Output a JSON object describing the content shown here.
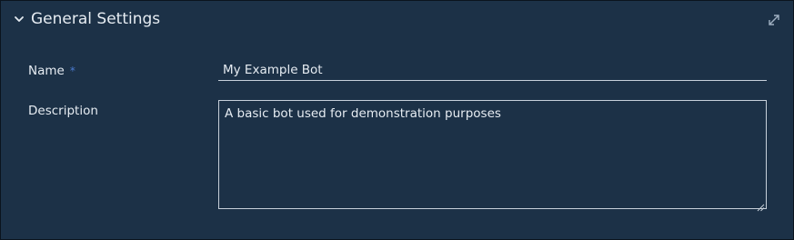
{
  "section": {
    "title": "General Settings",
    "collapse_icon": "chevron-down-icon",
    "expand_icon": "expand-arrows-icon"
  },
  "form": {
    "name": {
      "label": "Name",
      "required_marker": "*",
      "value": "My Example Bot"
    },
    "description": {
      "label": "Description",
      "value": "A basic bot used for demonstration purposes"
    }
  },
  "colors": {
    "background": "#1c3147",
    "text": "#e6ecf2",
    "field_border": "#c7d0da",
    "required_accent": "#4b7bd0"
  }
}
